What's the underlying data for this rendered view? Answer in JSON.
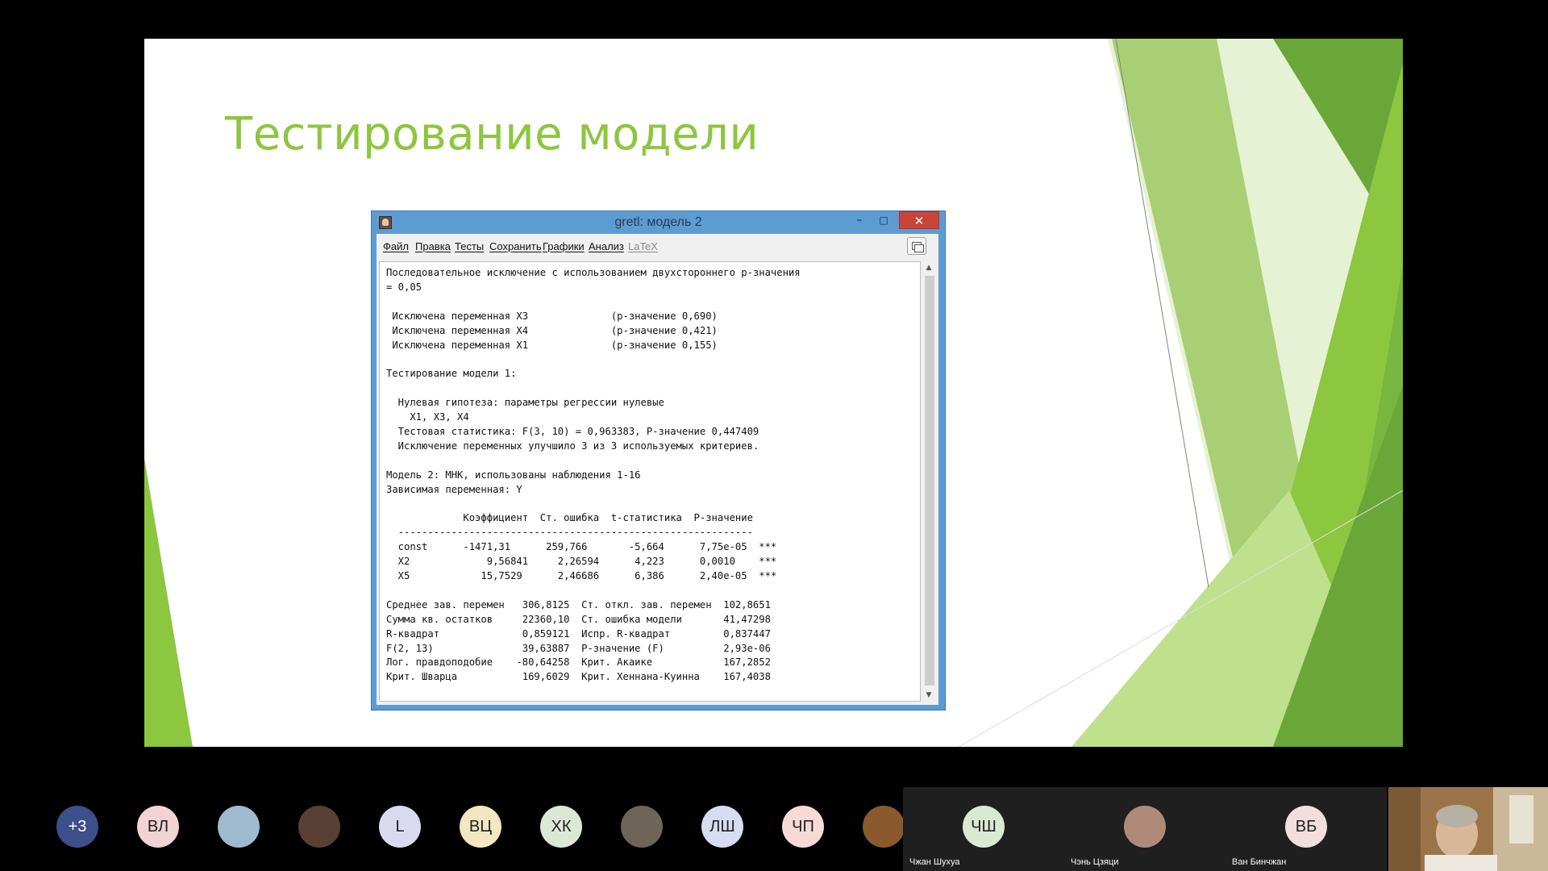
{
  "slide": {
    "title": "Тестирование модели",
    "colors": {
      "title": "#8dc63f",
      "accent_green": "#8dc63f",
      "dark_green": "#6aa638"
    }
  },
  "gretl_window": {
    "title": "gretl: модель 2",
    "controls": {
      "minimize": "–",
      "maximize": "□",
      "close": "✕"
    },
    "menu": [
      "Файл",
      "Правка",
      "Тесты",
      "Сохранить",
      "Графики",
      "Анализ",
      "LaTeX"
    ],
    "menu_disabled": [
      "LaTeX"
    ],
    "output_lines": [
      "Последовательное исключение с использованием двухстороннего p-значения",
      "= 0,05",
      "",
      " Исключена переменная X3              (p-значение 0,690)",
      " Исключена переменная X4              (p-значение 0,421)",
      " Исключена переменная X1              (p-значение 0,155)",
      "",
      "Тестирование модели 1:",
      "",
      "  Нулевая гипотеза: параметры регрессии нулевые",
      "    X1, X3, X4",
      "  Тестовая статистика: F(3, 10) = 0,963383, P-значение 0,447409",
      "  Исключение переменных улучшило 3 из 3 используемых критериев.",
      "",
      "Модель 2: МНК, использованы наблюдения 1-16",
      "Зависимая переменная: Y",
      "",
      "             Коэффициент  Ст. ошибка  t-статистика  P-значение",
      "  ------------------------------------------------------------",
      "  const      -1471,31      259,766       -5,664      7,75e-05  ***",
      "  X2             9,56841     2,26594      4,223      0,0010    ***",
      "  X5            15,7529      2,46686      6,386      2,40e-05  ***",
      "",
      "Среднее зав. перемен   306,8125  Ст. откл. зав. перемен  102,8651",
      "Сумма кв. остатков     22360,10  Ст. ошибка модели       41,47298",
      "R-квадрат              0,859121  Испр. R-квадрат         0,837447",
      "F(2, 13)               39,63887  Р-значение (F)          2,93e-06",
      "Лог. правдоподобие    -80,64258  Крит. Акаике            167,2852",
      "Крит. Шварца           169,6029  Крит. Хеннана-Куинна    167,4038"
    ]
  },
  "meeting": {
    "participants": [
      {
        "initials": "+3",
        "bg": "#3d4f8a",
        "fg": "#ffffff"
      },
      {
        "initials": "ВЛ",
        "bg": "#f1d3d3",
        "fg": "#222222"
      },
      {
        "initials": "",
        "bg": "#9fb9cf",
        "fg": "#222222"
      },
      {
        "initials": "",
        "bg": "#5a4034",
        "fg": "#222222"
      },
      {
        "initials": "L",
        "bg": "#d9d9f0",
        "fg": "#222222"
      },
      {
        "initials": "ВЦ",
        "bg": "#f5e6c2",
        "fg": "#222222"
      },
      {
        "initials": "ХК",
        "bg": "#dce8d6",
        "fg": "#222222"
      },
      {
        "initials": "",
        "bg": "#6f6458",
        "fg": "#222222"
      },
      {
        "initials": "ЛШ",
        "bg": "#d6dcf2",
        "fg": "#222222"
      },
      {
        "initials": "ЧП",
        "bg": "#f7dad6",
        "fg": "#222222"
      },
      {
        "initials": "",
        "bg": "#8a5a2e",
        "fg": "#222222"
      }
    ],
    "named_tiles": [
      {
        "initials": "ЧШ",
        "name": "Чжан Шухуа",
        "bg": "#d9ead3",
        "fg": "#222222"
      },
      {
        "initials": "",
        "name": "Чэнь Цзяци",
        "bg": "#b08a78",
        "fg": "#222222"
      },
      {
        "initials": "ВБ",
        "name": "Ван Бинчжан",
        "bg": "#f2dede",
        "fg": "#222222"
      }
    ]
  }
}
